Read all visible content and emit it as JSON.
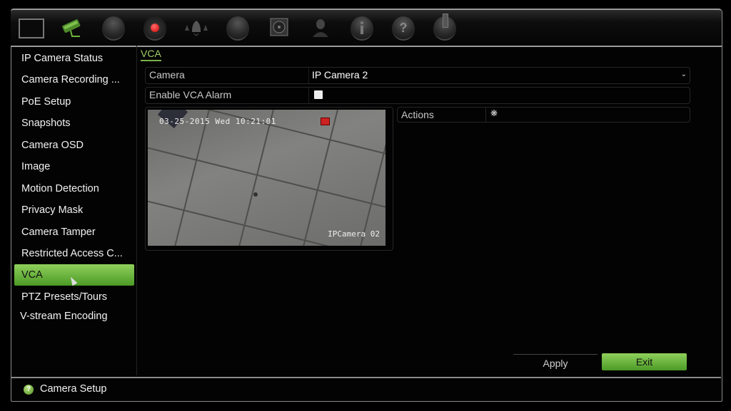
{
  "topbar": {
    "icons": [
      {
        "name": "display-icon",
        "active": false
      },
      {
        "name": "camera-icon",
        "active": true
      },
      {
        "name": "network-icon",
        "active": false
      },
      {
        "name": "record-icon",
        "active": false
      },
      {
        "name": "alarm-icon",
        "active": false
      },
      {
        "name": "device-icon",
        "active": false
      },
      {
        "name": "storage-icon",
        "active": false
      },
      {
        "name": "user-icon",
        "active": false
      },
      {
        "name": "info-icon",
        "active": false
      },
      {
        "name": "help-icon",
        "active": false
      },
      {
        "name": "power-icon",
        "active": false
      }
    ]
  },
  "sidebar": {
    "items": [
      {
        "label": "IP Camera Status"
      },
      {
        "label": "Camera Recording ..."
      },
      {
        "label": "PoE Setup"
      },
      {
        "label": "Snapshots"
      },
      {
        "label": "Camera OSD"
      },
      {
        "label": "Image"
      },
      {
        "label": "Motion Detection"
      },
      {
        "label": "Privacy Mask"
      },
      {
        "label": "Camera Tamper"
      },
      {
        "label": "Restricted Access C..."
      },
      {
        "label": "VCA",
        "active": true
      },
      {
        "label": "PTZ Presets/Tours"
      },
      {
        "label": "V-stream Encoding"
      }
    ]
  },
  "content": {
    "tab": "VCA",
    "camera_label": "Camera",
    "camera_value": "IP Camera 2",
    "enable_label": "Enable VCA Alarm",
    "enable_checked": false,
    "actions_label": "Actions",
    "preview": {
      "timestamp": "03-25-2015 Wed 10:21:01",
      "camera_name": "IPCamera 02"
    },
    "apply_label": "Apply",
    "exit_label": "Exit"
  },
  "status": {
    "text": "Camera Setup"
  },
  "colors": {
    "accent_green": "#6cb43a",
    "tab_text": "#9fcf6a"
  }
}
